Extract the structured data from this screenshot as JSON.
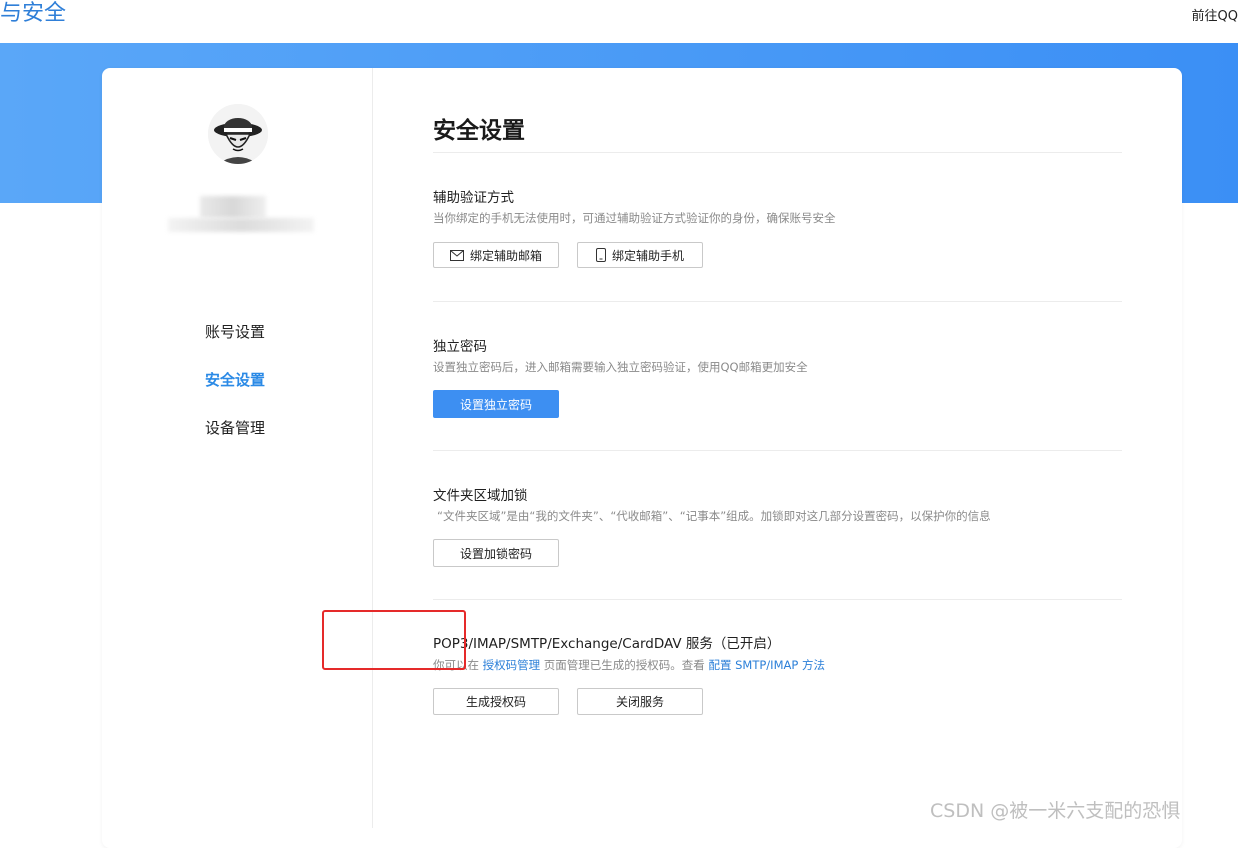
{
  "topbar": {
    "brand": "与安全",
    "goto": "前往QQ"
  },
  "sidebar": {
    "items": [
      {
        "label": "账号设置",
        "active": false
      },
      {
        "label": "安全设置",
        "active": true
      },
      {
        "label": "设备管理",
        "active": false
      }
    ]
  },
  "main": {
    "title": "安全设置",
    "sections": [
      {
        "title": "辅助验证方式",
        "desc": "当你绑定的手机无法使用时，可通过辅助验证方式验证你的身份，确保账号安全",
        "buttons": [
          {
            "label": "绑定辅助邮箱",
            "icon": "mail-icon"
          },
          {
            "label": "绑定辅助手机",
            "icon": "phone-icon"
          }
        ]
      },
      {
        "title": "独立密码",
        "desc": "设置独立密码后，进入邮箱需要输入独立密码验证，使用QQ邮箱更加安全",
        "buttons": [
          {
            "label": "设置独立密码"
          }
        ]
      },
      {
        "title": "文件夹区域加锁",
        "desc": "“文件夹区域”是由“我的文件夹”、“代收邮箱”、“记事本”组成。加锁即对这几部分设置密码，以保护你的信息",
        "buttons": [
          {
            "label": "设置加锁密码"
          }
        ]
      },
      {
        "title": "POP3/IMAP/SMTP/Exchange/CardDAV 服务（已开启）",
        "desc_parts": {
          "before": "你可以在 ",
          "link1": "授权码管理",
          "middle": " 页面管理已生成的授权码。查看 ",
          "link2": "配置 SMTP/IMAP 方法"
        },
        "buttons": [
          {
            "label": "生成授权码"
          },
          {
            "label": "关闭服务"
          }
        ]
      }
    ]
  },
  "watermark": "CSDN @被一米六支配的恐惧",
  "colors": {
    "accent": "#3d8ff2",
    "banner": "#4a9bf6",
    "highlight": "#e52a2a"
  }
}
